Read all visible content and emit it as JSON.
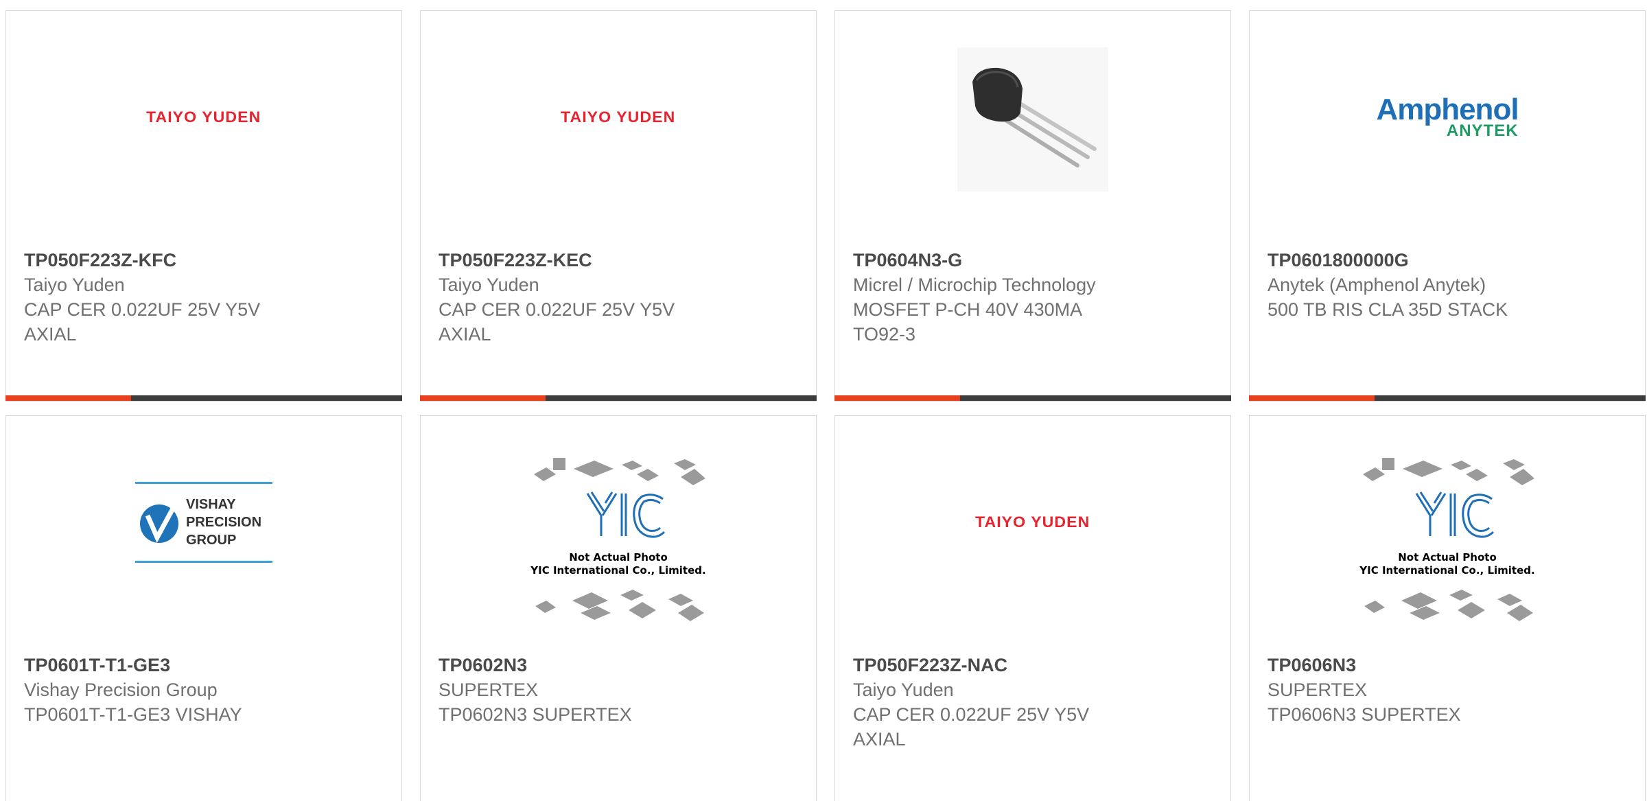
{
  "brand_colors": {
    "accent": "#e8401c",
    "bar": "#3c3c3c",
    "taiyo_red": "#e6242f",
    "amphenol_blue": "#1f6fb6",
    "anytek_green": "#1f9b64",
    "vishay_blue": "#3aa0d8"
  },
  "logos": {
    "taiyo": "TAIYO YUDEN",
    "amphenol_top": "Amphenol",
    "amphenol_bottom": "ANYTEK",
    "vishay_1": "VISHAY",
    "vishay_2": "PRECISION",
    "vishay_3": "GROUP",
    "yic_caption_1": "Not Actual Photo",
    "yic_caption_2": "YIC International Co., Limited."
  },
  "products": [
    {
      "part_number": "TP050F223Z-KFC",
      "manufacturer": "Taiyo Yuden",
      "desc_line1": "CAP CER 0.022UF 25V Y5V",
      "desc_line2": "AXIAL",
      "image": "taiyo-yuden-logo"
    },
    {
      "part_number": "TP050F223Z-KEC",
      "manufacturer": "Taiyo Yuden",
      "desc_line1": "CAP CER 0.022UF 25V Y5V",
      "desc_line2": "AXIAL",
      "image": "taiyo-yuden-logo"
    },
    {
      "part_number": "TP0604N3-G",
      "manufacturer": "Micrel / Microchip Technology",
      "desc_line1": "MOSFET P-CH 40V 430MA",
      "desc_line2": "TO92-3",
      "image": "to92-transistor-photo"
    },
    {
      "part_number": "TP0601800000G",
      "manufacturer": "Anytek (Amphenol Anytek)",
      "desc_line1": "500 TB RIS CLA 35D STACK",
      "desc_line2": "",
      "image": "amphenol-anytek-logo"
    },
    {
      "part_number": "TP0601T-T1-GE3",
      "manufacturer": "Vishay Precision Group",
      "desc_line1": "TP0601T-T1-GE3 VISHAY",
      "desc_line2": "",
      "image": "vishay-precision-group-logo"
    },
    {
      "part_number": "TP0602N3",
      "manufacturer": "SUPERTEX",
      "desc_line1": "TP0602N3 SUPERTEX",
      "desc_line2": "",
      "image": "yic-placeholder"
    },
    {
      "part_number": "TP050F223Z-NAC",
      "manufacturer": "Taiyo Yuden",
      "desc_line1": "CAP CER 0.022UF 25V Y5V",
      "desc_line2": "AXIAL",
      "image": "taiyo-yuden-logo"
    },
    {
      "part_number": "TP0606N3",
      "manufacturer": "SUPERTEX",
      "desc_line1": "TP0606N3 SUPERTEX",
      "desc_line2": "",
      "image": "yic-placeholder"
    }
  ]
}
